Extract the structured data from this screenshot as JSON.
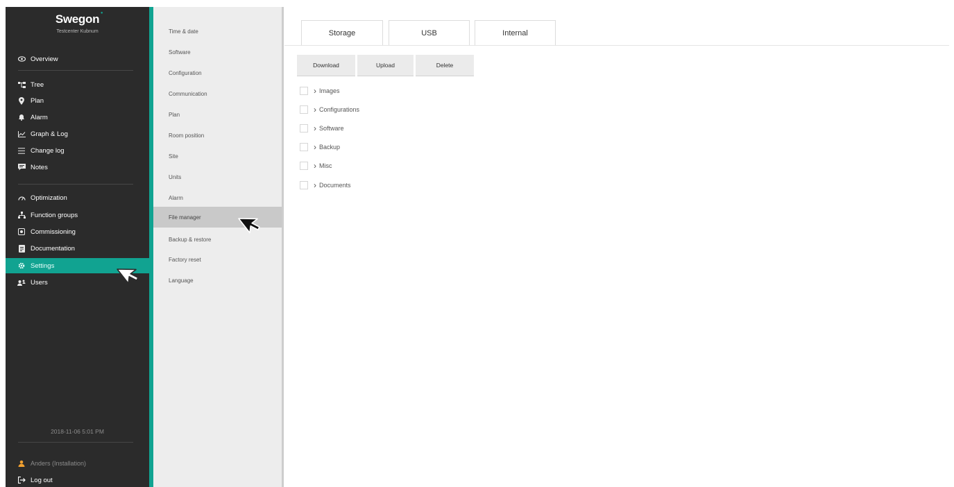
{
  "brand": {
    "logo": "Swegon",
    "site": "Testcenter Kubnum"
  },
  "nav": {
    "overview": "Overview",
    "tree": "Tree",
    "plan": "Plan",
    "alarm": "Alarm",
    "graph_log": "Graph & Log",
    "change_log": "Change log",
    "notes": "Notes",
    "optimization": "Optimization",
    "function_groups": "Function groups",
    "commissioning": "Commissioning",
    "documentation": "Documentation",
    "settings": "Settings",
    "users": "Users"
  },
  "footer": {
    "datetime": "2018-11-06 5:01 PM",
    "user": "Anders (Installation)",
    "logout": "Log out"
  },
  "settings_menu": [
    "Time & date",
    "Software",
    "Configuration",
    "Communication",
    "Plan",
    "Room position",
    "Site",
    "Units",
    "Alarm",
    "File manager",
    "Backup & restore",
    "Factory reset",
    "Language"
  ],
  "tabs": [
    "Storage",
    "USB",
    "Internal"
  ],
  "actions": {
    "download": "Download",
    "upload": "Upload",
    "delete": "Delete"
  },
  "folders": [
    "Images",
    "Configurations",
    "Software",
    "Backup",
    "Misc",
    "Documents"
  ],
  "colors": {
    "accent": "#11a391",
    "sidebar": "#2b2b2b",
    "submenu": "#ededed"
  }
}
